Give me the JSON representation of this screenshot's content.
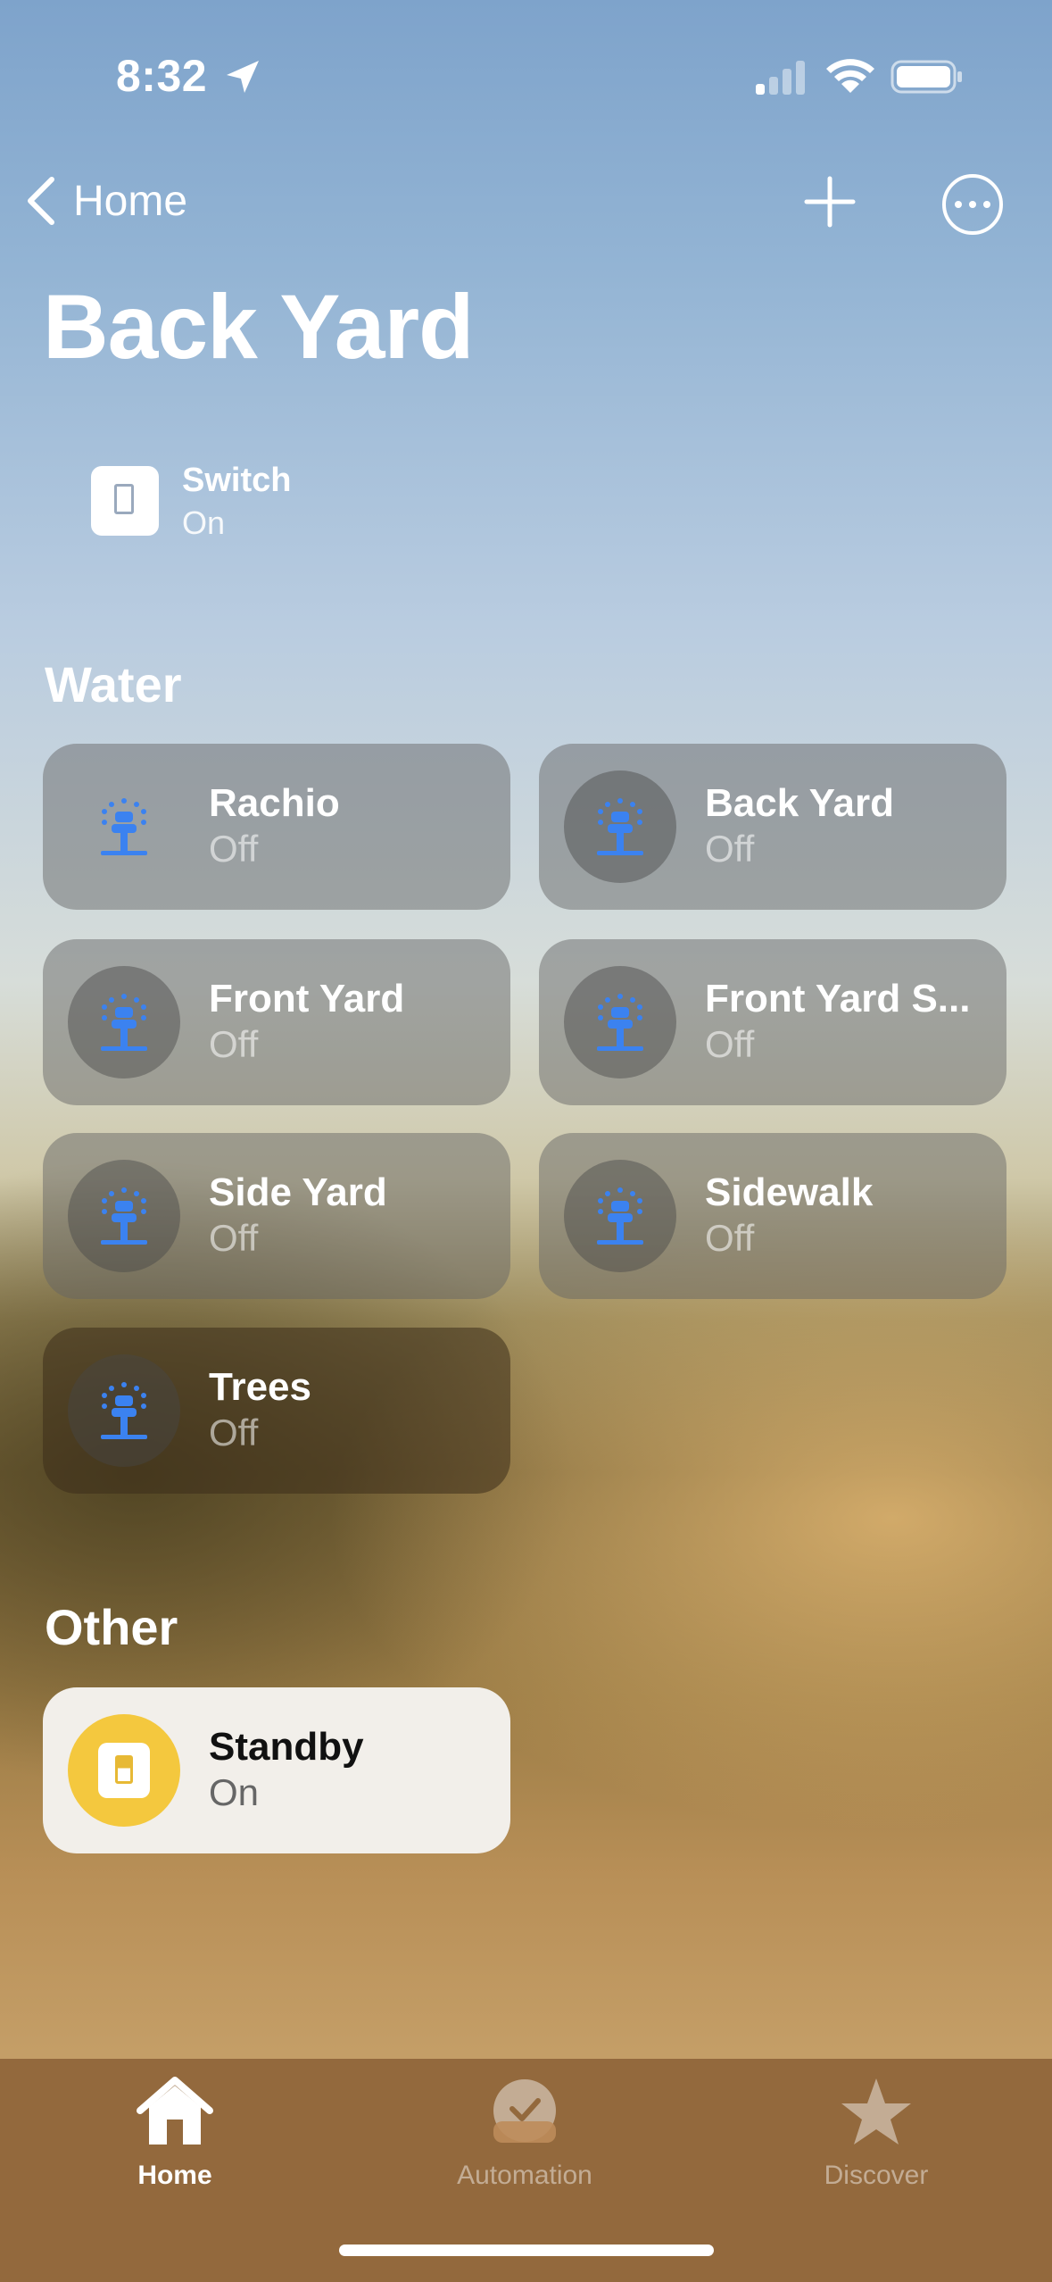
{
  "status_bar": {
    "time": "8:32",
    "icons": [
      "location-arrow-icon",
      "cellular-signal-icon",
      "wifi-icon",
      "battery-icon"
    ]
  },
  "nav": {
    "back_label": "Home",
    "add_icon": "plus-icon",
    "more_icon": "ellipsis-circle-icon"
  },
  "page_title": "Back Yard",
  "top_accessory": {
    "name": "Switch",
    "state": "On",
    "icon": "switch-icon"
  },
  "sections": {
    "water": {
      "title": "Water",
      "tiles": [
        {
          "name": "Rachio",
          "state": "Off",
          "icon": "sprinkler-icon"
        },
        {
          "name": "Back Yard",
          "state": "Off",
          "icon": "sprinkler-icon"
        },
        {
          "name": "Front Yard",
          "state": "Off",
          "icon": "sprinkler-icon"
        },
        {
          "name": "Front Yard S...",
          "state": "Off",
          "icon": "sprinkler-icon"
        },
        {
          "name": "Side Yard",
          "state": "Off",
          "icon": "sprinkler-icon"
        },
        {
          "name": "Sidewalk",
          "state": "Off",
          "icon": "sprinkler-icon"
        },
        {
          "name": "Trees",
          "state": "Off",
          "icon": "sprinkler-icon"
        }
      ]
    },
    "other": {
      "title": "Other",
      "tiles": [
        {
          "name": "Standby",
          "state": "On",
          "icon": "switch-icon",
          "accent": "#f4c83e"
        }
      ]
    }
  },
  "tab_bar": {
    "tabs": [
      {
        "label": "Home",
        "icon": "house-icon",
        "active": true
      },
      {
        "label": "Automation",
        "icon": "clock-check-icon",
        "active": false
      },
      {
        "label": "Discover",
        "icon": "star-icon",
        "active": false
      }
    ]
  },
  "colors": {
    "sprinkler": "#3b82f0",
    "tab_bar": "#93693d",
    "standby_accent": "#f4c83e"
  }
}
